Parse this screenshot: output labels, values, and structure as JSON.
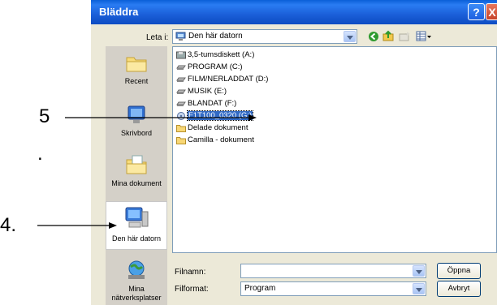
{
  "window": {
    "title": "Bläddra",
    "help_glyph": "?",
    "close_glyph": "X"
  },
  "lookin": {
    "label": "Leta i:",
    "value": "Den här datorn"
  },
  "places": [
    {
      "label": "Recent",
      "icon": "recent-folder-icon"
    },
    {
      "label": "Skrivbord",
      "icon": "desktop-icon"
    },
    {
      "label": "Mina dokument",
      "icon": "my-documents-icon"
    },
    {
      "label": "Den här datorn",
      "icon": "my-computer-icon",
      "selected": true
    },
    {
      "label": "Mina nätverksplatser",
      "icon": "network-places-icon"
    }
  ],
  "files": [
    {
      "name": "3,5-tumsdiskett (A:)",
      "icon": "floppy-drive-icon"
    },
    {
      "name": "PROGRAM (C:)",
      "icon": "hard-drive-icon"
    },
    {
      "name": "FILM/NERLADDAT (D:)",
      "icon": "hard-drive-icon"
    },
    {
      "name": "MUSIK (E:)",
      "icon": "hard-drive-icon"
    },
    {
      "name": "BLANDAT (F:)",
      "icon": "hard-drive-icon"
    },
    {
      "name": "F1T100_0320 (G:)",
      "icon": "removable-drive-icon",
      "selected": true
    },
    {
      "name": "Delade dokument",
      "icon": "folder-icon"
    },
    {
      "name": "Camilla - dokument",
      "icon": "folder-icon"
    }
  ],
  "filename": {
    "label": "Filnamn:",
    "value": ""
  },
  "filetype": {
    "label": "Filformat:",
    "value": "Program"
  },
  "buttons": {
    "open": "Öppna",
    "cancel": "Avbryt"
  },
  "annotations": {
    "five": "5",
    "dot": ".",
    "four": "4."
  }
}
